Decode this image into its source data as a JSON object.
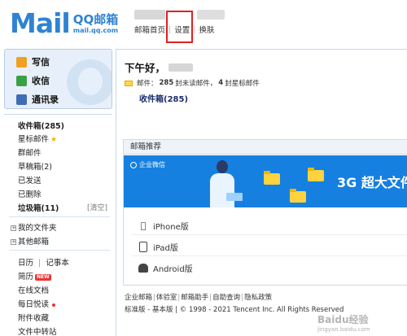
{
  "header": {
    "logo_text": "Mail",
    "logo_brand": "QQ邮箱",
    "logo_url": "mail.qq.com",
    "nav": [
      "邮箱首页",
      "设置",
      "换肤"
    ]
  },
  "sidebar": {
    "primary": [
      {
        "label": "写信",
        "icon": "pencil-icon"
      },
      {
        "label": "收信",
        "icon": "inbox-download-icon"
      },
      {
        "label": "通讯录",
        "icon": "address-book-icon"
      }
    ],
    "folders": {
      "inbox": "收件箱(285)",
      "starred": "星标邮件",
      "group": "群邮件",
      "drafts": "草稿箱(2)",
      "sent": "已发送",
      "deleted": "已删除",
      "spam": "垃圾箱(11)",
      "spam_clear": "[清空]",
      "my_folders": "我的文件夹",
      "other_mailboxes": "其他邮箱",
      "calendar": "日历",
      "notes": "记事本",
      "resume": "简历",
      "new_badge": "NEW",
      "online_docs": "在线文档",
      "daily": "每日悦读",
      "attachments": "附件收藏",
      "file_transfer": "文件中转站"
    }
  },
  "main": {
    "greeting": "下午好，",
    "stats": {
      "prefix": "邮件：",
      "unread": "285",
      "unread_label": "封未读邮件，",
      "starred": "4",
      "starred_label": "封星标邮件"
    },
    "inbox_link": "收件箱(285)",
    "recommend": {
      "title": "邮箱推荐",
      "banner_brand": "企业微信",
      "banner_headline": "3G 超大文件",
      "clients": [
        "iPhone版",
        "iPad版",
        "Android版"
      ]
    },
    "footer_links": [
      "企业邮箱",
      "体验室",
      "邮箱助手",
      "自助查询",
      "隐私政策"
    ],
    "copyright": "标准版 - 基本版 | © 1998 - 2021 Tencent Inc. All Rights Reserved"
  },
  "watermark": {
    "text": "Baidu经验",
    "url": "jingyan.baidu.com"
  },
  "colors": {
    "brand": "#2f83d3",
    "banner": "#1680e0",
    "highlight": "#e02020"
  }
}
